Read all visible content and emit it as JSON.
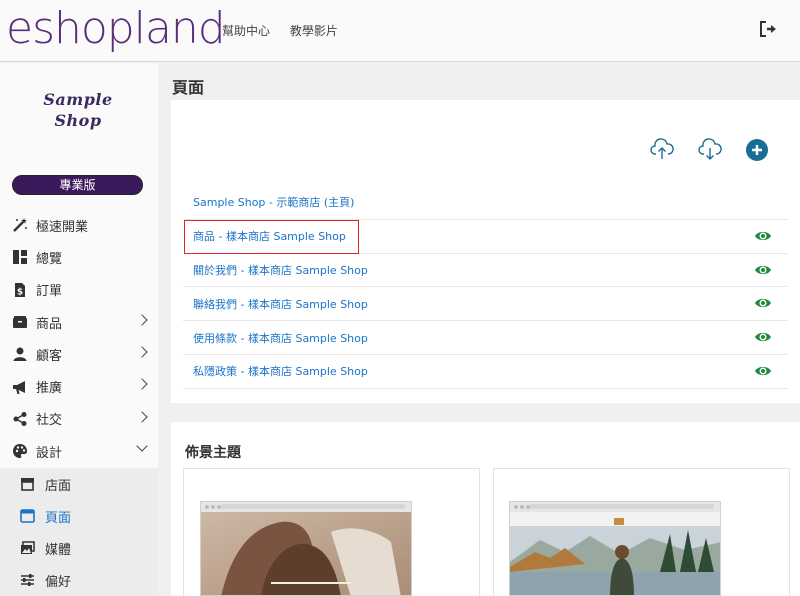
{
  "header": {
    "logo": "eshopland",
    "nav": [
      "幫助中心",
      "教學影片"
    ],
    "logout_icon": "logout-icon"
  },
  "sidebar": {
    "shop_logo": [
      "Sample",
      "Shop"
    ],
    "plan_badge": "專業版",
    "items": [
      {
        "label": "極速開業",
        "icon": "magic-wand-icon",
        "chevron": "none"
      },
      {
        "label": "總覽",
        "icon": "dashboard-icon",
        "chevron": "none"
      },
      {
        "label": "訂單",
        "icon": "invoice-icon",
        "chevron": "none"
      },
      {
        "label": "商品",
        "icon": "box-icon",
        "chevron": "right"
      },
      {
        "label": "顧客",
        "icon": "user-icon",
        "chevron": "right"
      },
      {
        "label": "推廣",
        "icon": "megaphone-icon",
        "chevron": "right"
      },
      {
        "label": "社交",
        "icon": "share-icon",
        "chevron": "right"
      },
      {
        "label": "設計",
        "icon": "palette-icon",
        "chevron": "down"
      }
    ],
    "sub_items": [
      {
        "label": "店面",
        "icon": "store-icon",
        "active": false
      },
      {
        "label": "頁面",
        "icon": "page-icon",
        "active": true
      },
      {
        "label": "媒體",
        "icon": "images-icon",
        "active": false
      },
      {
        "label": "偏好",
        "icon": "sliders-icon",
        "active": false
      }
    ]
  },
  "main": {
    "title": "頁面",
    "toolbar": {
      "upload_icon": "cloud-upload-icon",
      "download_icon": "cloud-download-icon",
      "add_icon": "add-circle-icon"
    },
    "pages": [
      {
        "label": "Sample Shop - 示範商店 (主頁)",
        "visible": false
      },
      {
        "label": "商品 - 樣本商店 Sample Shop",
        "visible": true
      },
      {
        "label": "關於我們 - 樣本商店 Sample Shop",
        "visible": true
      },
      {
        "label": "聯絡我們 - 樣本商店 Sample Shop",
        "visible": true
      },
      {
        "label": "使用條款 - 樣本商店 Sample Shop",
        "visible": true
      },
      {
        "label": "私隱政策 - 樣本商店 Sample Shop",
        "visible": true
      }
    ],
    "themes_title": "佈景主題"
  },
  "colors": {
    "brand": "#5a2d7a",
    "link": "#1a73c8",
    "eye": "#1e8a3c",
    "highlight": "#d8262b"
  }
}
